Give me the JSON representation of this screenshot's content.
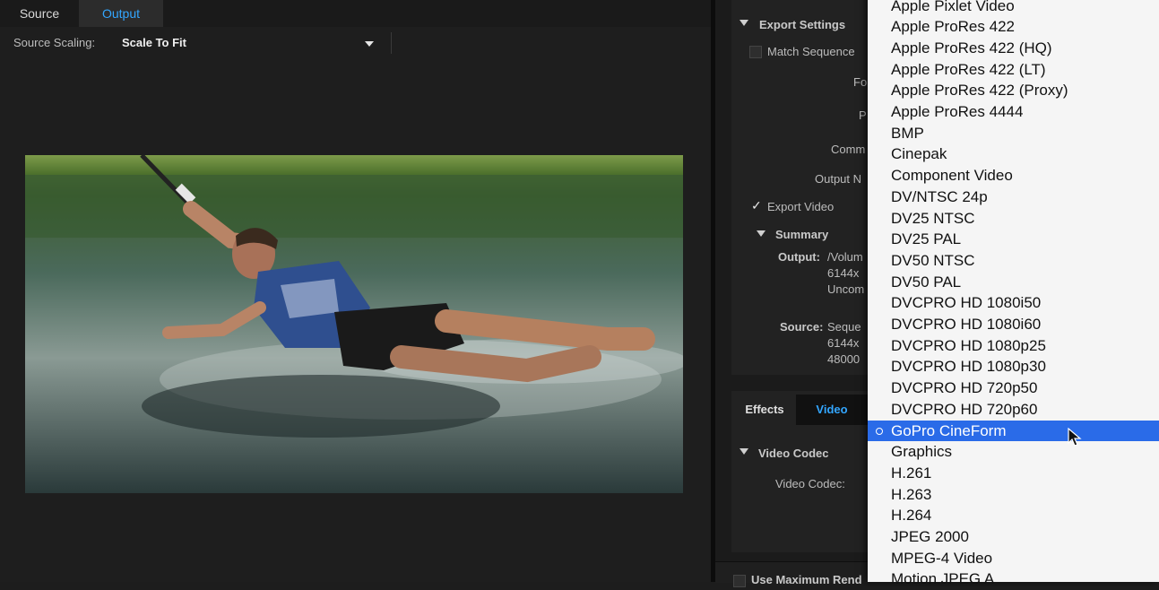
{
  "tabs": {
    "source": "Source",
    "output": "Output"
  },
  "source_scaling": {
    "label": "Source Scaling:",
    "value": "Scale To Fit"
  },
  "export_settings": {
    "section_title": "Export Settings",
    "match_sequence_label": "Match Sequence",
    "format_label": "Fo",
    "preset_label": "P",
    "comments_label": "Comm",
    "output_name_label": "Output N",
    "export_video_label": "Export Video",
    "export_video_checked": true,
    "summary_title": "Summary",
    "output_key": "Output:",
    "output_lines": [
      "/Volum",
      "6144x",
      "Uncom"
    ],
    "source_key": "Source:",
    "source_lines": [
      "Seque",
      "6144x",
      "48000"
    ]
  },
  "panel_tabs": {
    "effects": "Effects",
    "video": "Video"
  },
  "video_codec": {
    "section_title": "Video Codec",
    "label": "Video Codec:"
  },
  "bottom_option": "Use Maximum Rend",
  "format_menu": {
    "items": [
      "Apple Pixlet Video",
      "Apple ProRes 422",
      "Apple ProRes 422 (HQ)",
      "Apple ProRes 422 (LT)",
      "Apple ProRes 422 (Proxy)",
      "Apple ProRes 4444",
      "BMP",
      "Cinepak",
      "Component Video",
      "DV/NTSC 24p",
      "DV25 NTSC",
      "DV25 PAL",
      "DV50 NTSC",
      "DV50 PAL",
      "DVCPRO HD 1080i50",
      "DVCPRO HD 1080i60",
      "DVCPRO HD 1080p25",
      "DVCPRO HD 1080p30",
      "DVCPRO HD 720p50",
      "DVCPRO HD 720p60",
      "GoPro CineForm",
      "Graphics",
      "H.261",
      "H.263",
      "H.264",
      "JPEG 2000",
      "MPEG-4 Video",
      "Motion JPEG A"
    ],
    "selected_index": 20
  },
  "preview": {
    "description_icon": "video-frame-preview"
  },
  "colors": {
    "accent": "#33a6ff",
    "menu_selection": "#2a6be8",
    "panel_bg": "#1e1e1e"
  }
}
